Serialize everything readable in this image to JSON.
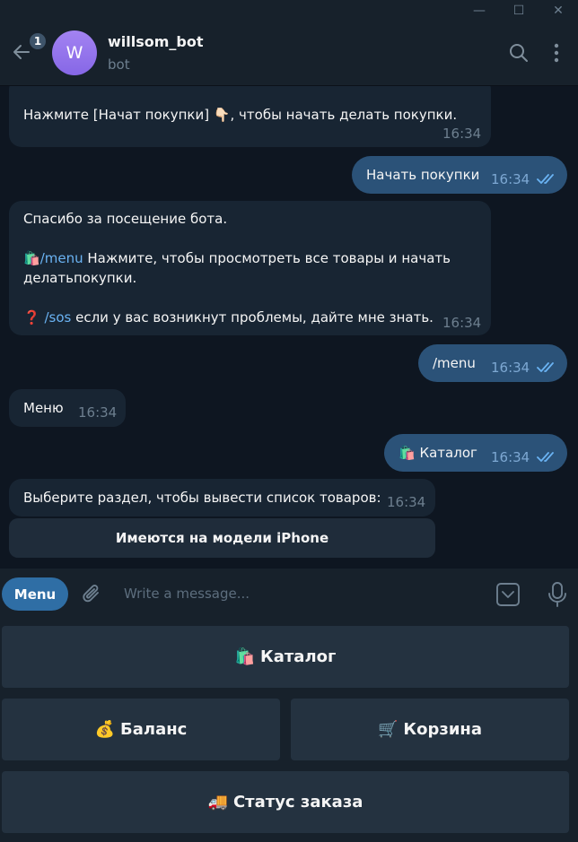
{
  "window": {
    "minimize": "—",
    "maximize": "☐",
    "close": "✕"
  },
  "header": {
    "unread_count": "1",
    "avatar_letter": "W",
    "chat_name": "willsom_bot",
    "status": "bot"
  },
  "messages": [
    {
      "id": "m1",
      "direction": "in",
      "lines": [
        "Нажмите [Начат покупки] 👇🏻, чтобы начать делать покупки."
      ],
      "time": "16:34"
    },
    {
      "id": "m2",
      "direction": "out",
      "text": "Начать покупки",
      "time": "16:34",
      "read": true
    },
    {
      "id": "m3",
      "direction": "in",
      "line1": "Спасибо за посещение бота.",
      "menu_emoji": "🛍️",
      "menu_cmd": "/menu",
      "menu_text": " Нажмите, чтобы просмотреть все товары и начать",
      "menu_text2": "делатьпокупки.",
      "sos_emoji": "❓",
      "sos_cmd": "/sos",
      "sos_text": " если у вас возникнут проблемы, дайте мне знать.",
      "time": "16:34"
    },
    {
      "id": "m4",
      "direction": "out",
      "text": "/menu",
      "time": "16:34",
      "read": true
    },
    {
      "id": "m5",
      "direction": "in",
      "text": "Меню",
      "time": "16:34"
    },
    {
      "id": "m6",
      "direction": "out",
      "emoji": "🛍️",
      "text": "Каталог",
      "time": "16:34",
      "read": true
    },
    {
      "id": "m7",
      "direction": "in",
      "text": "Выберите раздел, чтобы вывести список товаров:",
      "time": "16:34",
      "inline_button": "Имеются на модели  iPhone"
    }
  ],
  "composer": {
    "menu_label": "Menu",
    "placeholder": "Write a message..."
  },
  "keyboard": [
    {
      "emoji": "🛍️",
      "label": "Каталог"
    },
    {
      "emoji": "💰",
      "label": "Баланс"
    },
    {
      "emoji": "🛒",
      "label": "Корзина"
    },
    {
      "emoji": "🚚",
      "label": "Статус заказа"
    }
  ],
  "colors": {
    "background": "#0e1621",
    "panel": "#17212b",
    "incoming": "#182533",
    "outgoing": "#2b5278",
    "accent": "#2f6ea5",
    "link": "#6ab3f3"
  }
}
